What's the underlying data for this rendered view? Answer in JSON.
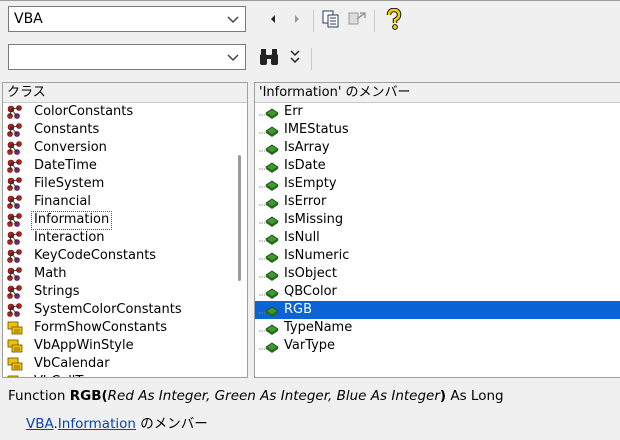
{
  "toolbar": {
    "library_value": "VBA",
    "search_value": ""
  },
  "classes": {
    "header": "クラス",
    "items": [
      {
        "label": "ColorConstants",
        "kind": "module"
      },
      {
        "label": "Constants",
        "kind": "module"
      },
      {
        "label": "Conversion",
        "kind": "module"
      },
      {
        "label": "DateTime",
        "kind": "module"
      },
      {
        "label": "FileSystem",
        "kind": "module"
      },
      {
        "label": "Financial",
        "kind": "module"
      },
      {
        "label": "Information",
        "kind": "module"
      },
      {
        "label": "Interaction",
        "kind": "module"
      },
      {
        "label": "KeyCodeConstants",
        "kind": "module"
      },
      {
        "label": "Math",
        "kind": "module"
      },
      {
        "label": "Strings",
        "kind": "module"
      },
      {
        "label": "SystemColorConstants",
        "kind": "module"
      },
      {
        "label": "FormShowConstants",
        "kind": "enum"
      },
      {
        "label": "VbAppWinStyle",
        "kind": "enum"
      },
      {
        "label": "VbCalendar",
        "kind": "enum"
      },
      {
        "label": "VbCallType",
        "kind": "enum"
      }
    ]
  },
  "members": {
    "header": "'Information' のメンバー",
    "items": [
      {
        "label": "Err"
      },
      {
        "label": "IMEStatus"
      },
      {
        "label": "IsArray"
      },
      {
        "label": "IsDate"
      },
      {
        "label": "IsEmpty"
      },
      {
        "label": "IsError"
      },
      {
        "label": "IsMissing"
      },
      {
        "label": "IsNull"
      },
      {
        "label": "IsNumeric"
      },
      {
        "label": "IsObject"
      },
      {
        "label": "QBColor"
      },
      {
        "label": "RGB"
      },
      {
        "label": "TypeName"
      },
      {
        "label": "VarType"
      }
    ]
  },
  "details": {
    "keyword": "Function",
    "name": "RGB",
    "open_paren": "(",
    "params": "Red As Integer, Green As Integer, Blue As Integer",
    "close_paren": ")",
    "returns": "As Long",
    "library_link": "VBA",
    "dot": ".",
    "class_link": "Information",
    "member_suffix": " のメンバー"
  },
  "colors": {
    "selection": "#0a64d6",
    "link": "#0645ad",
    "method_icon": "#3a9a2a"
  }
}
